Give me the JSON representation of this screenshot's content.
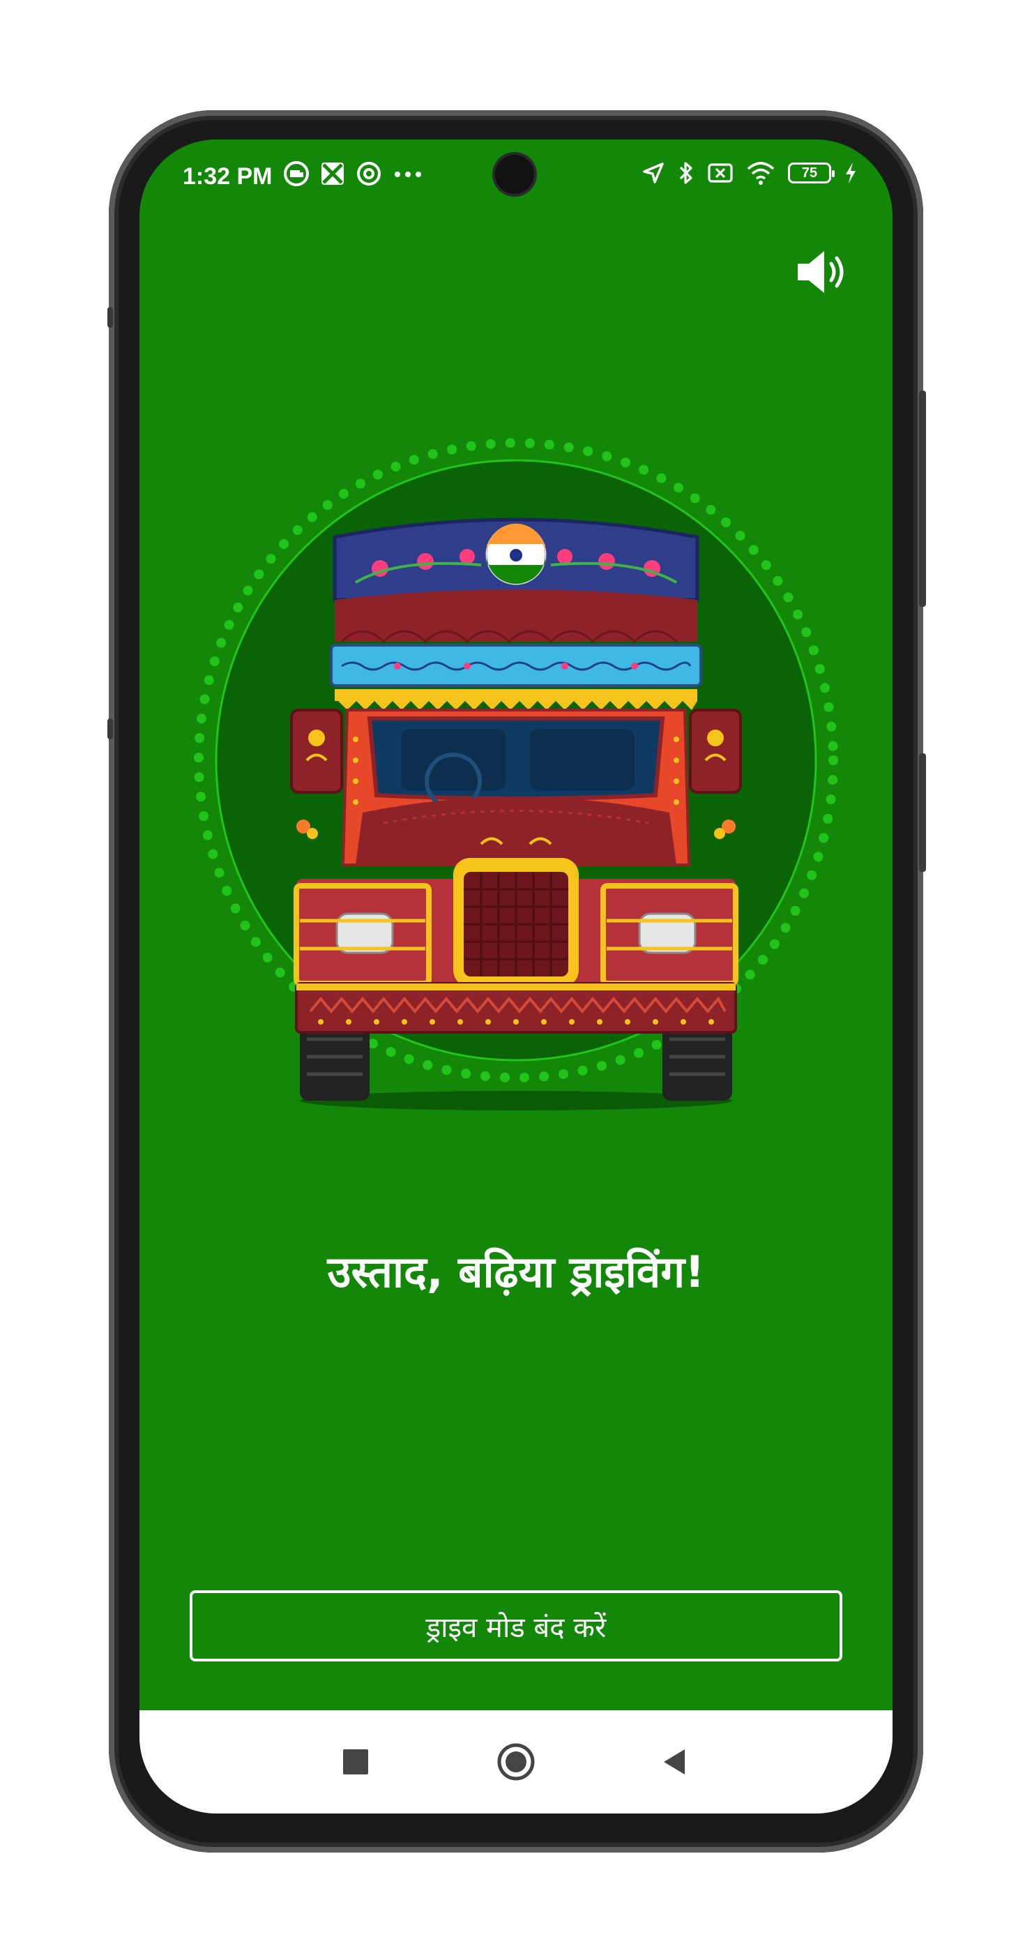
{
  "status_bar": {
    "time": "1:32 PM",
    "battery_level": "75",
    "left_icons": [
      "truck-badge-icon",
      "crossed-tiles-icon",
      "at-circle-icon",
      "more-dots-icon"
    ],
    "right_icons": [
      "location-arrow-icon",
      "bluetooth-icon",
      "no-sim-icon",
      "wifi-icon",
      "battery-icon",
      "charging-bolt-icon"
    ]
  },
  "header": {
    "sound_icon": "speaker-volume-icon"
  },
  "main": {
    "illustration": "decorated-truck-illustration",
    "message": "उस्ताद, बढ़िया ड्राइविंग!",
    "stop_drive_mode_label": "ड्राइव मोड बंद करें"
  },
  "nav_bar": {
    "items": [
      "recents-square-icon",
      "home-circle-icon",
      "back-triangle-icon"
    ]
  },
  "colors": {
    "screen_background": "#138808",
    "circle_inner": "#0a6405",
    "dots": "#1fc21a",
    "text": "#ffffff"
  }
}
